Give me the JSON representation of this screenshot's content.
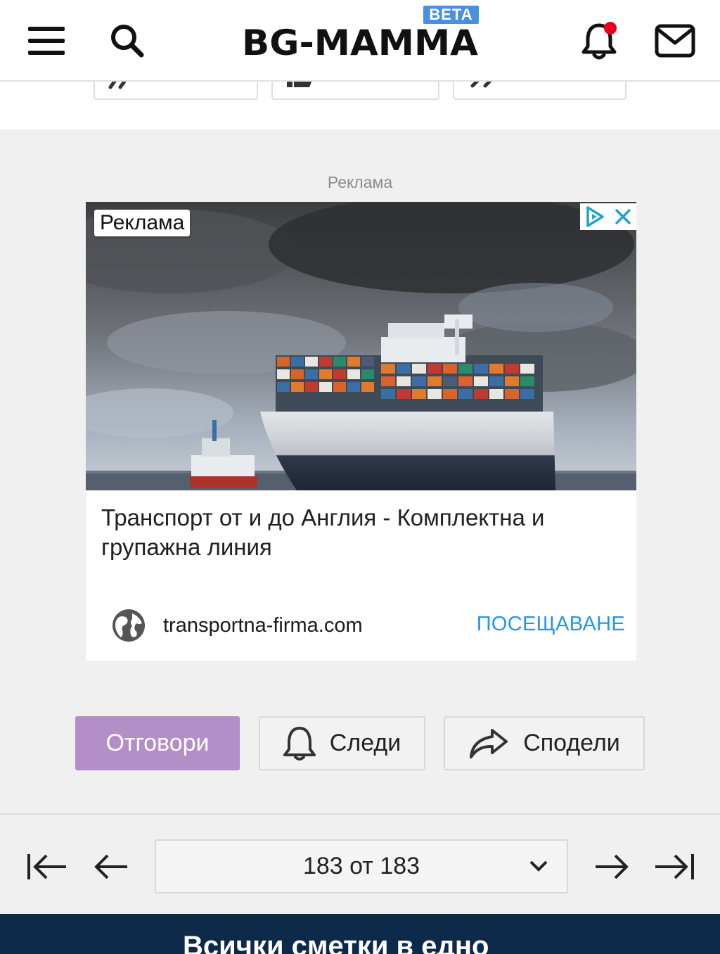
{
  "header": {
    "logo_text": "BG-MAMMA",
    "beta_badge": "BETA"
  },
  "ad": {
    "caption": "Реклама",
    "image_label": "Реклама",
    "title": "Транспорт от и до Англия - Комплектна и групажна линия",
    "domain": "transportna-firma.com",
    "cta": "ПОСЕЩАВАНЕ"
  },
  "actions": {
    "reply": "Отговори",
    "follow": "Следи",
    "share": "Сподели"
  },
  "pagination": {
    "current_page": "183 от 183"
  },
  "bottom_banner": {
    "text": "Всички сметки в едно"
  },
  "colors": {
    "brand": "#111111",
    "beta": "#4a90e2",
    "reply_button": "#b48ec6",
    "cta": "#2196f3",
    "notification_dot": "#e8001c",
    "banner": "#0e2a4a"
  }
}
